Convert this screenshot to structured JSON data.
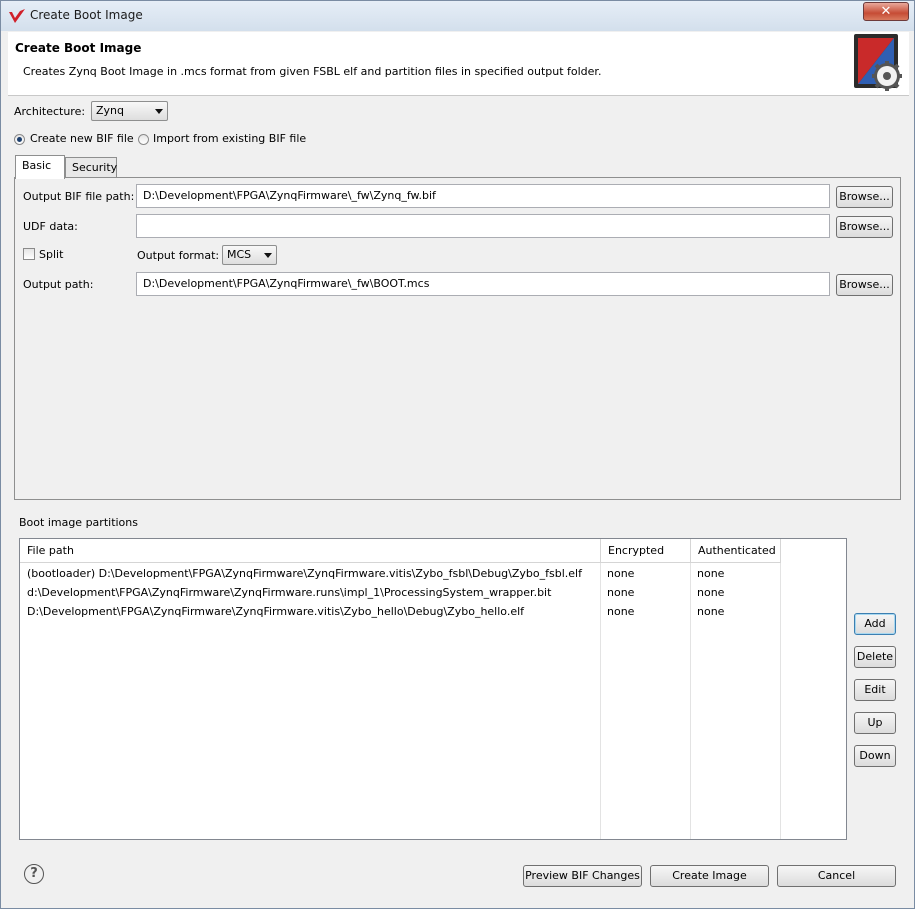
{
  "window": {
    "title": "Create Boot Image",
    "close_label": "✕"
  },
  "header": {
    "title": "Create Boot Image",
    "description": "Creates Zynq Boot Image in .mcs format from given FSBL elf and partition files in specified output folder."
  },
  "architecture": {
    "label": "Architecture:",
    "value": "Zynq"
  },
  "bif_mode": {
    "create_new_label": "Create new BIF file",
    "import_label": "Import from existing BIF file",
    "selected": "create_new"
  },
  "tabs": [
    {
      "label": "Basic",
      "active": true
    },
    {
      "label": "Security",
      "active": false
    }
  ],
  "basic": {
    "output_bif_label": "Output BIF file path:",
    "output_bif_value": "D:\\Development\\FPGA\\ZynqFirmware\\_fw\\Zynq_fw.bif",
    "udf_label": "UDF data:",
    "udf_value": "",
    "split_label": "Split",
    "split_checked": false,
    "output_format_label": "Output format:",
    "output_format_value": "MCS",
    "output_path_label": "Output path:",
    "output_path_value": "D:\\Development\\FPGA\\ZynqFirmware\\_fw\\BOOT.mcs",
    "browse_label": "Browse..."
  },
  "partitions": {
    "section_label": "Boot image partitions",
    "columns": [
      "File path",
      "Encrypted",
      "Authenticated"
    ],
    "rows": [
      [
        "(bootloader) D:\\Development\\FPGA\\ZynqFirmware\\ZynqFirmware.vitis\\Zybo_fsbl\\Debug\\Zybo_fsbl.elf",
        "none",
        "none"
      ],
      [
        "d:\\Development\\FPGA\\ZynqFirmware\\ZynqFirmware.runs\\impl_1\\ProcessingSystem_wrapper.bit",
        "none",
        "none"
      ],
      [
        "D:\\Development\\FPGA\\ZynqFirmware\\ZynqFirmware.vitis\\Zybo_hello\\Debug\\Zybo_hello.elf",
        "none",
        "none"
      ]
    ],
    "buttons": {
      "add": "Add",
      "delete": "Delete",
      "edit": "Edit",
      "up": "Up",
      "down": "Down"
    }
  },
  "footer": {
    "help_label": "?",
    "preview_label": "Preview BIF Changes",
    "create_label": "Create Image",
    "cancel_label": "Cancel"
  },
  "colors": {
    "accent": "#3c7fb1",
    "close": "#c64c35",
    "logo": "#d0202a"
  }
}
